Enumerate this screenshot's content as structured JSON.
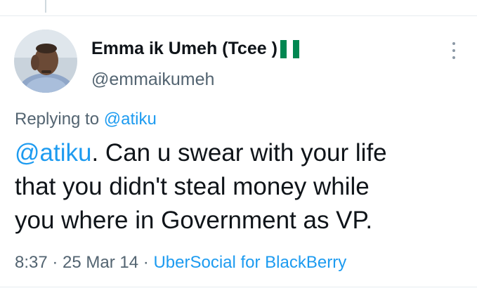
{
  "tweet": {
    "author": {
      "display_name": "Emma ik Umeh (Tcee )",
      "flag_icon": "nigeria-flag-icon",
      "handle": "@emmaikumeh"
    },
    "menu_icon": "more-options-icon",
    "replying": {
      "prefix": "Replying to ",
      "handle": "@atiku"
    },
    "body": {
      "mention": "@atiku",
      "line1_rest": ". Can u swear with your life",
      "line2": "that you didn't steal money while",
      "line3": "you where in Government as VP."
    },
    "meta": {
      "time": "8:37",
      "separator": " · ",
      "date": "25 Mar 14",
      "separator2": " · ",
      "source": "UberSocial for BlackBerry"
    },
    "colors": {
      "link": "#1d9bf0",
      "text": "#0f1419",
      "secondary": "#536471",
      "flag_green": "#008751"
    }
  }
}
